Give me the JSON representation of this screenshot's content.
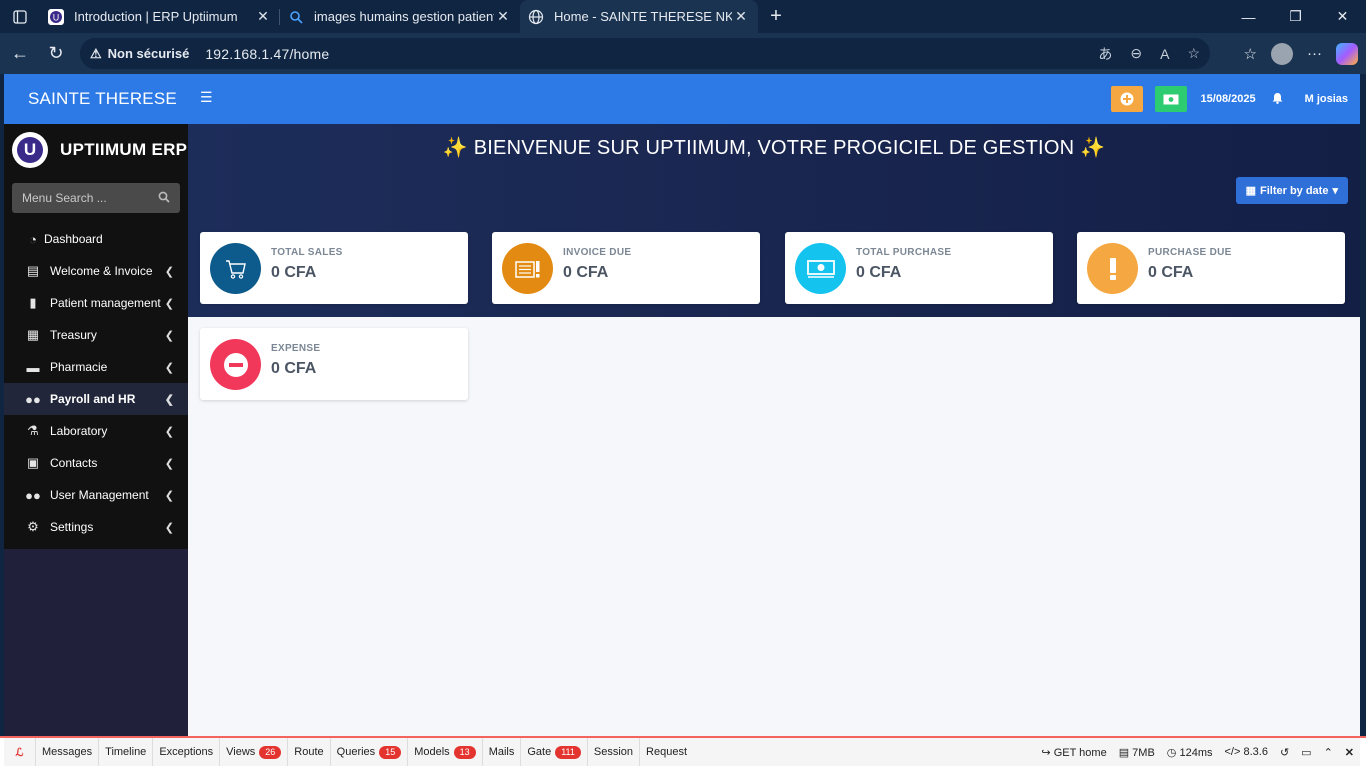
{
  "browser": {
    "tabs": [
      {
        "title": "Introduction | ERP Uptiimum",
        "icon": "uptiimum-favicon-icon"
      },
      {
        "title": "images humains gestion patients",
        "icon": "search-icon"
      },
      {
        "title": "Home - SAINTE THERESE NKOLFO",
        "icon": "globe-icon"
      }
    ],
    "security_label": "Non sécurisé",
    "url": "192.168.1.47/home"
  },
  "app": {
    "brand": "SAINTE THERESE",
    "logo_text": "UPTIIMUM ERP",
    "search_placeholder": "Menu Search ...",
    "menu": [
      {
        "label": "Dashboard",
        "icon": "dashboard-icon"
      },
      {
        "label": "Welcome & Invoice",
        "icon": "file-invoice-icon"
      },
      {
        "label": "Patient management",
        "icon": "file-icon"
      },
      {
        "label": "Treasury",
        "icon": "building-icon"
      },
      {
        "label": "Pharmacie",
        "icon": "truck-medical-icon"
      },
      {
        "label": "Payroll and HR",
        "icon": "users-icon"
      },
      {
        "label": "Laboratory",
        "icon": "microscope-icon"
      },
      {
        "label": "Contacts",
        "icon": "address-book-icon"
      },
      {
        "label": "User Management",
        "icon": "users-cog-icon"
      },
      {
        "label": "Settings",
        "icon": "gear-icon"
      }
    ],
    "date": "15/08/2025",
    "user": "M josias",
    "welcome": "✨ BIENVENUE SUR UPTIIMUM, VOTRE PROGICIEL DE GESTION ✨",
    "filter_label": "Filter by date",
    "cards": [
      {
        "label": "TOTAL SALES",
        "value": "0 CFA",
        "color": "#0d5b8c",
        "icon": "cart-icon"
      },
      {
        "label": "INVOICE DUE",
        "value": "0 CFA",
        "color": "#e28a12",
        "icon": "invoice-alert-icon"
      },
      {
        "label": "TOTAL PURCHASE",
        "value": "0 CFA",
        "color": "#15c3ef",
        "icon": "money-icon"
      },
      {
        "label": "PURCHASE DUE",
        "value": "0 CFA",
        "color": "#f5a742",
        "icon": "exclamation-icon"
      },
      {
        "label": "EXPENSE",
        "value": "0 CFA",
        "color": "#f2385a",
        "icon": "minus-circle-icon"
      }
    ]
  },
  "debugbar": {
    "items": [
      {
        "label": "Messages"
      },
      {
        "label": "Timeline"
      },
      {
        "label": "Exceptions"
      },
      {
        "label": "Views",
        "count": "26"
      },
      {
        "label": "Route"
      },
      {
        "label": "Queries",
        "count": "15"
      },
      {
        "label": "Models",
        "count": "13"
      },
      {
        "label": "Mails"
      },
      {
        "label": "Gate",
        "count": "111"
      },
      {
        "label": "Session"
      },
      {
        "label": "Request"
      }
    ],
    "route": "GET home",
    "memory": "7MB",
    "time": "124ms",
    "php": "8.3.6"
  }
}
